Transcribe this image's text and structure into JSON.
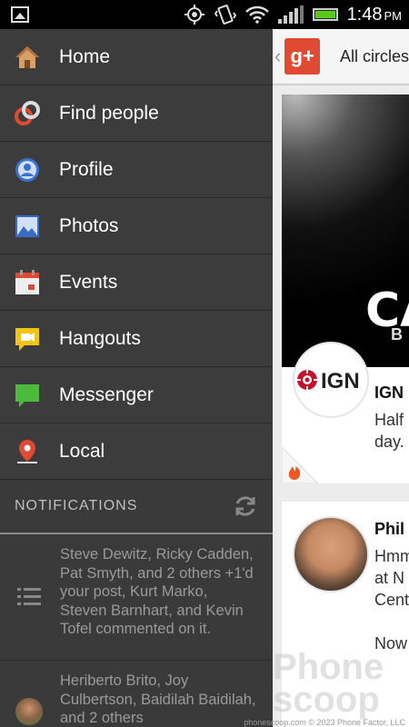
{
  "status_bar": {
    "time": "1:48",
    "ampm": "PM"
  },
  "drawer": {
    "items": [
      {
        "label": "Home",
        "icon": "home-icon"
      },
      {
        "label": "Find people",
        "icon": "find-people-icon"
      },
      {
        "label": "Profile",
        "icon": "profile-icon"
      },
      {
        "label": "Photos",
        "icon": "photos-icon"
      },
      {
        "label": "Events",
        "icon": "events-icon"
      },
      {
        "label": "Hangouts",
        "icon": "hangouts-icon"
      },
      {
        "label": "Messenger",
        "icon": "messenger-icon"
      },
      {
        "label": "Local",
        "icon": "local-icon"
      }
    ],
    "notifications_title": "NOTIFICATIONS",
    "notifications": [
      {
        "text": "Steve Dewitz, Ricky Cadden, Pat Smyth, and 2 others +1'd your post, Kurt Marko, Steven Barnhart, and Kevin Tofel commented on it."
      },
      {
        "text": "Heriberto Brito, Joy Culbertson, Baidilah Baidilah, and 2 others"
      }
    ]
  },
  "main": {
    "circles_label": "All circles",
    "gplus_label": "g+",
    "card1": {
      "image_text_big": "CA",
      "image_text_small": "B",
      "author": "IGN",
      "body_line1": "Half",
      "body_line2": "day."
    },
    "card2": {
      "author": "Phil",
      "body_lines": [
        "Hmm",
        "at N",
        "Cent",
        "",
        "Now"
      ]
    }
  },
  "watermark": "Phone scoop",
  "copyright": "phonescoop.com © 2023 Phone Factor, LLC"
}
